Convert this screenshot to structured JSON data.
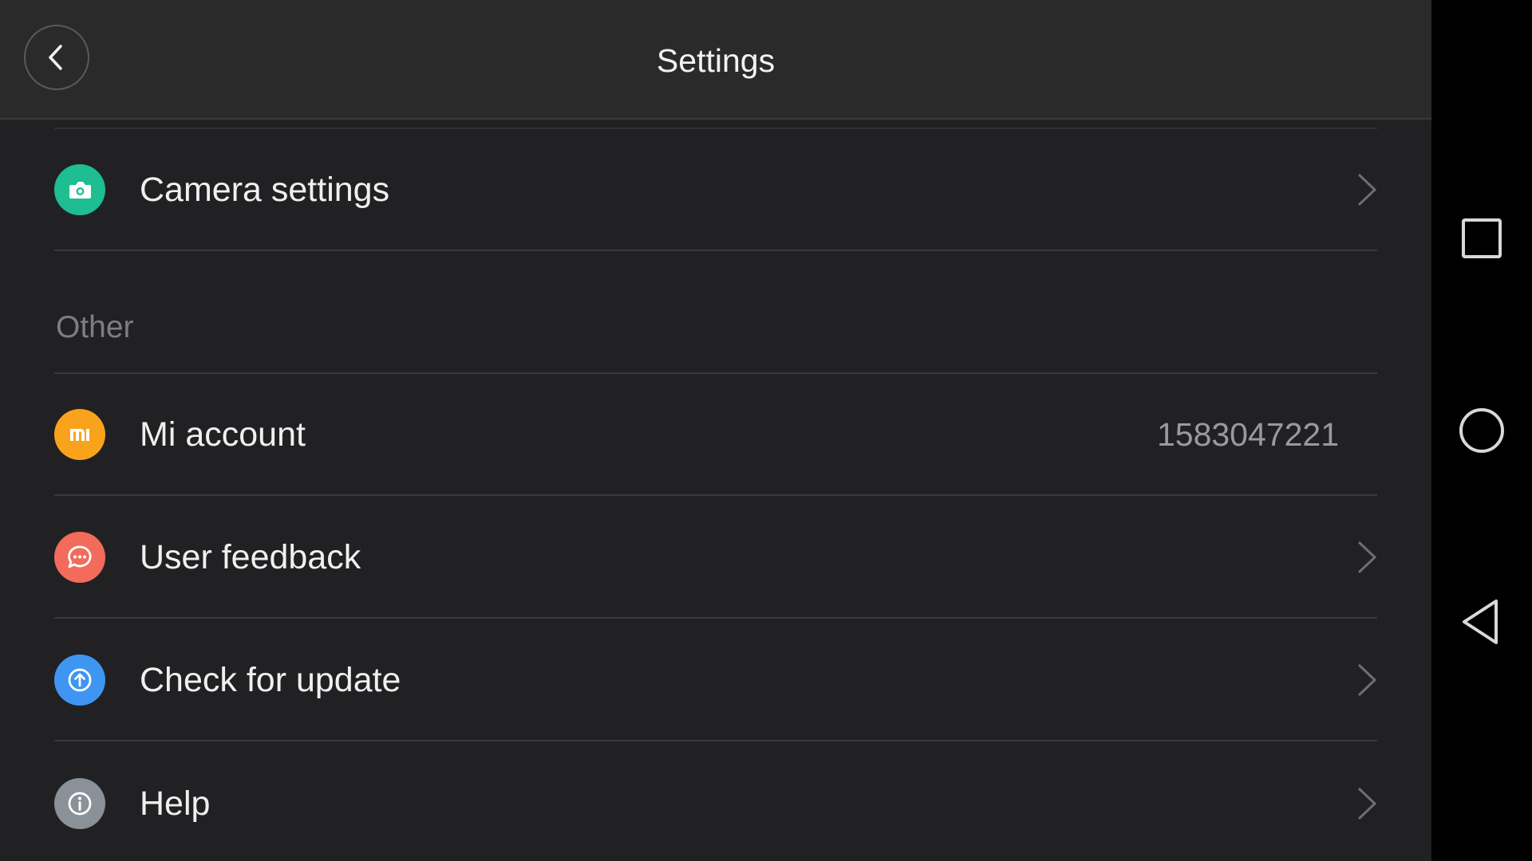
{
  "header": {
    "title": "Settings",
    "back_icon": "chevron-left-icon"
  },
  "rows_top": [
    {
      "label": "Camera settings",
      "icon": "camera-icon",
      "color": "#1ebd92"
    }
  ],
  "section_other": {
    "title": "Other",
    "items": [
      {
        "label": "Mi account",
        "icon": "mi-logo-icon",
        "color": "#f9a31c",
        "value": "1583047221"
      },
      {
        "label": "User feedback",
        "icon": "chat-bubble-icon",
        "color": "#f26b5b"
      },
      {
        "label": "Check for update",
        "icon": "upload-arrow-icon",
        "color": "#3f96f2"
      },
      {
        "label": "Help",
        "icon": "info-icon",
        "color": "#8a9199"
      }
    ]
  },
  "navbar": {
    "buttons": [
      "recents-square-icon",
      "home-circle-icon",
      "back-triangle-icon"
    ]
  },
  "colors": {
    "background": "#212123",
    "header_background": "#2a2a2b",
    "text_primary": "#f0f0f0",
    "text_secondary": "#9a9a9c",
    "section_header": "#7e7e80"
  }
}
